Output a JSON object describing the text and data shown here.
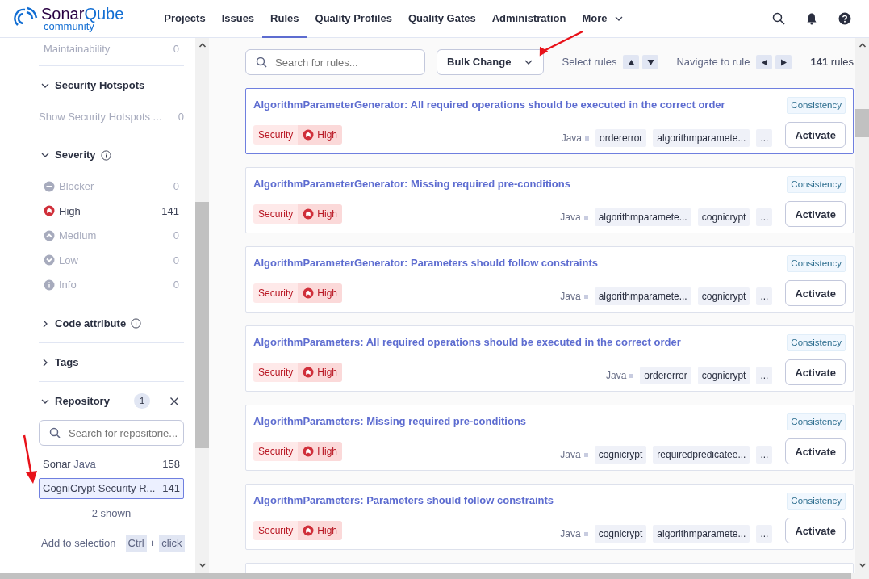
{
  "header": {
    "logo": {
      "name": "Sonar",
      "name_accent": "Qube",
      "edition": "community"
    },
    "nav": [
      {
        "label": "Projects",
        "selected": false
      },
      {
        "label": "Issues",
        "selected": false
      },
      {
        "label": "Rules",
        "selected": true
      },
      {
        "label": "Quality Profiles",
        "selected": false
      },
      {
        "label": "Quality Gates",
        "selected": false
      },
      {
        "label": "Administration",
        "selected": false
      },
      {
        "label": "More",
        "selected": false,
        "dropdown": true
      }
    ]
  },
  "sidebar": {
    "top_item": {
      "label": "Maintainability",
      "count": "0",
      "disabled": true
    },
    "sections": [
      {
        "kind": "facet",
        "title": "Security Hotspots",
        "expanded": true,
        "info": false,
        "items": [
          {
            "label": "Show Security Hotspots ...",
            "count": "0",
            "selected": false,
            "disabled": true
          }
        ]
      },
      {
        "kind": "facet",
        "title": "Severity",
        "expanded": true,
        "info": true,
        "items": [
          {
            "label": "Blocker",
            "count": "0",
            "selected": false,
            "disabled": true,
            "kind": "blocker"
          },
          {
            "label": "High",
            "count": "141",
            "selected": false,
            "disabled": false,
            "kind": "high"
          },
          {
            "label": "Medium",
            "count": "0",
            "selected": false,
            "disabled": true,
            "kind": "medium"
          },
          {
            "label": "Low",
            "count": "0",
            "selected": false,
            "disabled": true,
            "kind": "low"
          },
          {
            "label": "Info",
            "count": "0",
            "selected": false,
            "disabled": true,
            "kind": "info"
          }
        ]
      },
      {
        "kind": "facet",
        "title": "Code attribute",
        "expanded": false,
        "info": true
      },
      {
        "kind": "facet",
        "title": "Tags",
        "expanded": false,
        "info": false
      },
      {
        "kind": "repository",
        "title": "Repository",
        "expanded": true,
        "info": false,
        "badge": "1",
        "search": {
          "placeholder": "Search for repositorie..."
        },
        "items": [
          {
            "label": "Sonar",
            "language": "Java",
            "count": "158",
            "selected": false,
            "disabled": false
          },
          {
            "label": "CogniCrypt Security R...",
            "count": "141",
            "selected": true,
            "disabled": false
          }
        ],
        "shown": "2 shown",
        "hint": {
          "text": "Add to selection",
          "key": "Ctrl",
          "plus": "+",
          "action": "click"
        }
      }
    ]
  },
  "toolbar": {
    "search": {
      "placeholder": "Search for rules..."
    },
    "bulk_change": "Bulk Change",
    "select_rules": "Select rules",
    "navigate": "Navigate to rule",
    "count": "141",
    "count_label": "rules"
  },
  "rules": [
    {
      "title": "AlgorithmParameterGenerator: All required operations should be executed in the correct order",
      "attribute": "Consistency",
      "quality": "Security",
      "severity": "High",
      "language": "Java",
      "tags": [
        "ordererror",
        "algorithmparamete..."
      ],
      "more": "...",
      "action": "Activate",
      "selected": true
    },
    {
      "title": "AlgorithmParameterGenerator: Missing required pre-conditions",
      "attribute": "Consistency",
      "quality": "Security",
      "severity": "High",
      "language": "Java",
      "tags": [
        "algorithmparamete...",
        "cognicrypt"
      ],
      "more": "...",
      "action": "Activate",
      "selected": false
    },
    {
      "title": "AlgorithmParameterGenerator: Parameters should follow constraints",
      "attribute": "Consistency",
      "quality": "Security",
      "severity": "High",
      "language": "Java",
      "tags": [
        "algorithmparamete...",
        "cognicrypt"
      ],
      "more": "...",
      "action": "Activate",
      "selected": false
    },
    {
      "title": "AlgorithmParameters: All required operations should be executed in the correct order",
      "attribute": "Consistency",
      "quality": "Security",
      "severity": "High",
      "language": "Java",
      "tags": [
        "ordererror",
        "cognicrypt"
      ],
      "more": "...",
      "action": "Activate",
      "selected": false
    },
    {
      "title": "AlgorithmParameters: Missing required pre-conditions",
      "attribute": "Consistency",
      "quality": "Security",
      "severity": "High",
      "language": "Java",
      "tags": [
        "cognicrypt",
        "requiredpredicatee..."
      ],
      "more": "...",
      "action": "Activate",
      "selected": false
    },
    {
      "title": "AlgorithmParameters: Parameters should follow constraints",
      "attribute": "Consistency",
      "quality": "Security",
      "severity": "High",
      "language": "Java",
      "tags": [
        "cognicrypt",
        "algorithmparamete..."
      ],
      "more": "...",
      "action": "Activate",
      "selected": false
    }
  ]
}
